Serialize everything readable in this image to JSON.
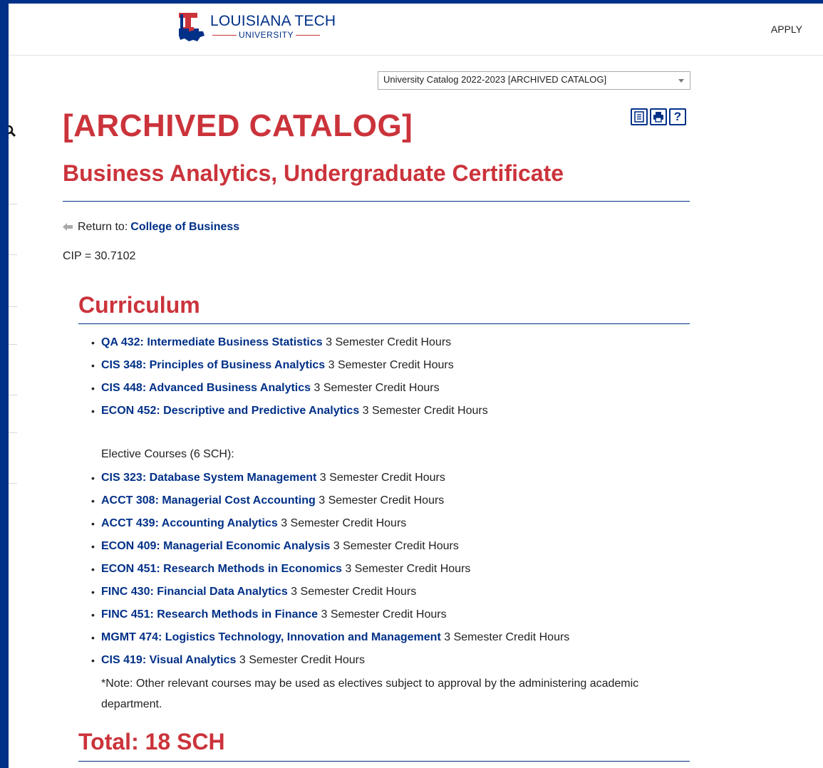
{
  "header": {
    "logo_title": "LOUISIANA TECH",
    "logo_subtitle": "UNIVERSITY",
    "apply_label": "APPLY"
  },
  "catalog_select": {
    "selected": "University Catalog 2022-2023 [ARCHIVED CATALOG]"
  },
  "toolbar": {
    "icons": [
      "document-icon",
      "print-icon",
      "help-icon"
    ],
    "help_glyph": "?"
  },
  "page": {
    "archived_heading": "[ARCHIVED CATALOG]",
    "program_title": "Business Analytics, Undergraduate Certificate",
    "return_prefix": "Return to:",
    "return_link": "College of Business",
    "cip": "CIP = 30.7102"
  },
  "curriculum": {
    "heading": "Curriculum",
    "required": [
      {
        "course": "QA 432: Intermediate Business Statistics",
        "hours": "3 Semester Credit Hours"
      },
      {
        "course": "CIS 348: Principles of Business Analytics",
        "hours": "3 Semester Credit Hours"
      },
      {
        "course": "CIS 448: Advanced Business Analytics",
        "hours": "3 Semester Credit Hours"
      },
      {
        "course": "ECON 452: Descriptive and Predictive Analytics",
        "hours": "3 Semester Credit Hours"
      }
    ],
    "elective_label": "Elective Courses (6 SCH):",
    "electives": [
      {
        "course": "CIS 323: Database System Management",
        "hours": "3 Semester Credit Hours"
      },
      {
        "course": "ACCT 308: Managerial Cost Accounting",
        "hours": "3 Semester Credit Hours"
      },
      {
        "course": "ACCT 439: Accounting Analytics",
        "hours": "3 Semester Credit Hours"
      },
      {
        "course": "ECON 409: Managerial Economic Analysis",
        "hours": "3 Semester Credit Hours"
      },
      {
        "course": "ECON 451: Research Methods in Economics",
        "hours": "3 Semester Credit Hours"
      },
      {
        "course": "FINC 430: Financial Data Analytics",
        "hours": "3 Semester Credit Hours"
      },
      {
        "course": "FINC 451: Research Methods in Finance",
        "hours": "3 Semester Credit Hours"
      },
      {
        "course": "MGMT 474: Logistics Technology, Innovation and Management",
        "hours": "3 Semester Credit Hours"
      },
      {
        "course": "CIS 419: Visual Analytics",
        "hours": "3 Semester Credit Hours"
      }
    ],
    "note": "*Note: Other relevant courses may be used as electives subject to approval by the administering academic department."
  },
  "total": {
    "heading": "Total: 18 SCH"
  },
  "colors": {
    "brand_blue": "#003087",
    "brand_red": "#cb333b"
  }
}
